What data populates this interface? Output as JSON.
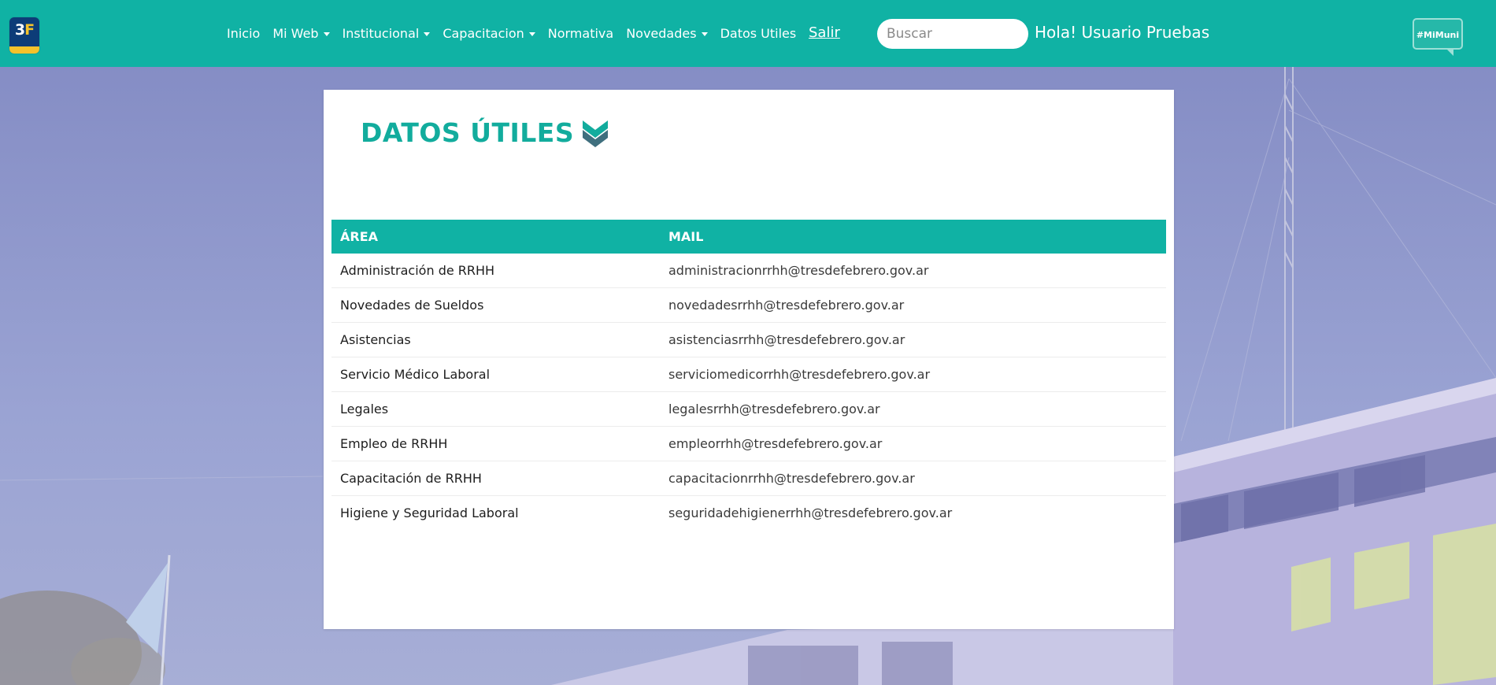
{
  "header": {
    "logo_text_a": "3",
    "logo_text_b": "F",
    "nav": [
      {
        "label": "Inicio",
        "dropdown": false
      },
      {
        "label": "Mi Web",
        "dropdown": true
      },
      {
        "label": "Institucional",
        "dropdown": true
      },
      {
        "label": "Capacitacion",
        "dropdown": true
      },
      {
        "label": "Normativa",
        "dropdown": false
      },
      {
        "label": "Novedades",
        "dropdown": true
      },
      {
        "label": "Datos Utiles",
        "dropdown": false
      }
    ],
    "logout_label": "Salir",
    "search_placeholder": "Buscar",
    "greeting": "Hola! Usuario Pruebas",
    "badge_label": "#MiMuni"
  },
  "main": {
    "title": "DATOS ÚTILES",
    "table": {
      "columns": [
        "ÁREA",
        "MAIL"
      ],
      "rows": [
        {
          "area": "Administración de RRHH",
          "mail": "administracionrrhh@tresdefebrero.gov.ar"
        },
        {
          "area": "Novedades de Sueldos",
          "mail": "novedadesrrhh@tresdefebrero.gov.ar"
        },
        {
          "area": "Asistencias",
          "mail": "asistenciasrrhh@tresdefebrero.gov.ar"
        },
        {
          "area": "Servicio Médico Laboral",
          "mail": "serviciomedicorrhh@tresdefebrero.gov.ar"
        },
        {
          "area": "Legales",
          "mail": "legalesrrhh@tresdefebrero.gov.ar"
        },
        {
          "area": "Empleo de RRHH",
          "mail": "empleorrhh@tresdefebrero.gov.ar"
        },
        {
          "area": "Capacitación de RRHH",
          "mail": "capacitacionrrhh@tresdefebrero.gov.ar"
        },
        {
          "area": "Higiene y Seguridad Laboral",
          "mail": "seguridadehigienerrhh@tresdefebrero.gov.ar"
        }
      ]
    }
  },
  "colors": {
    "brand_teal": "#10b2a4",
    "title_teal": "#12ac9d",
    "background_tint": "#8f97c9"
  }
}
